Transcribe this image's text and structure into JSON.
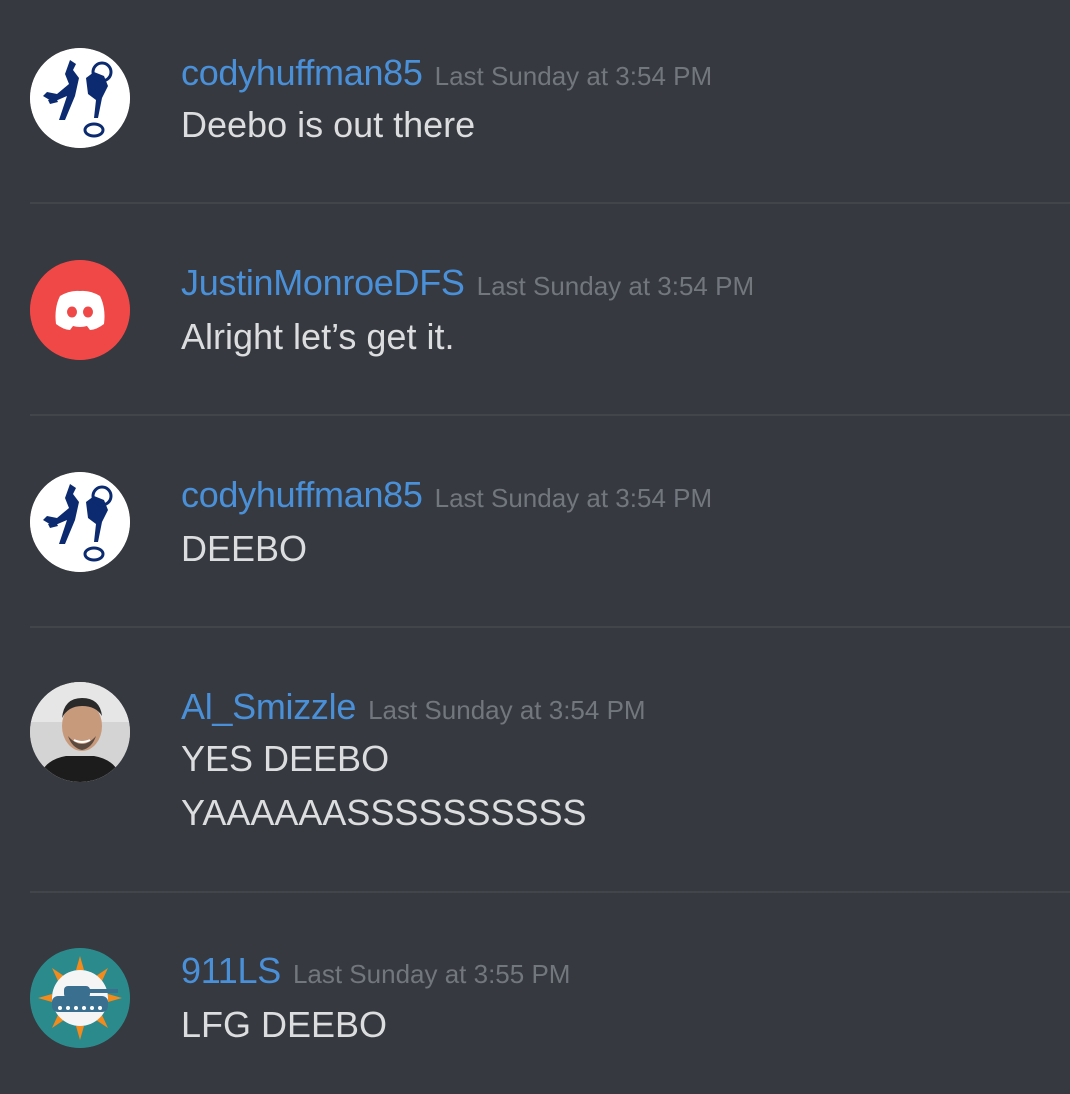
{
  "messages": [
    {
      "username": "codyhuffman85",
      "timestamp": "Last Sunday at 3:54 PM",
      "lines": [
        "Deebo is out there"
      ],
      "avatar": "colts-logo-avatar"
    },
    {
      "username": "JustinMonroeDFS",
      "timestamp": "Last Sunday at 3:54 PM",
      "lines": [
        "Alright let’s get it."
      ],
      "avatar": "discord-logo-avatar"
    },
    {
      "username": "codyhuffman85",
      "timestamp": "Last Sunday at 3:54 PM",
      "lines": [
        "DEEBO"
      ],
      "avatar": "colts-logo-avatar"
    },
    {
      "username": "Al_Smizzle",
      "timestamp": "Last Sunday at 3:54 PM",
      "lines": [
        "YES DEEBO",
        "YAAAAAASSSSSSSSSS"
      ],
      "avatar": "user-photo-avatar"
    },
    {
      "username": "911LS",
      "timestamp": "Last Sunday at 3:55 PM",
      "lines": [
        "LFG DEEBO"
      ],
      "avatar": "dolphins-tank-logo-avatar"
    }
  ],
  "colors": {
    "background": "#36393f",
    "username": "#4a90d9",
    "timestamp": "#72767d",
    "message_text": "#dcddde",
    "divider": "#42454a",
    "discord_red": "#f04747"
  }
}
